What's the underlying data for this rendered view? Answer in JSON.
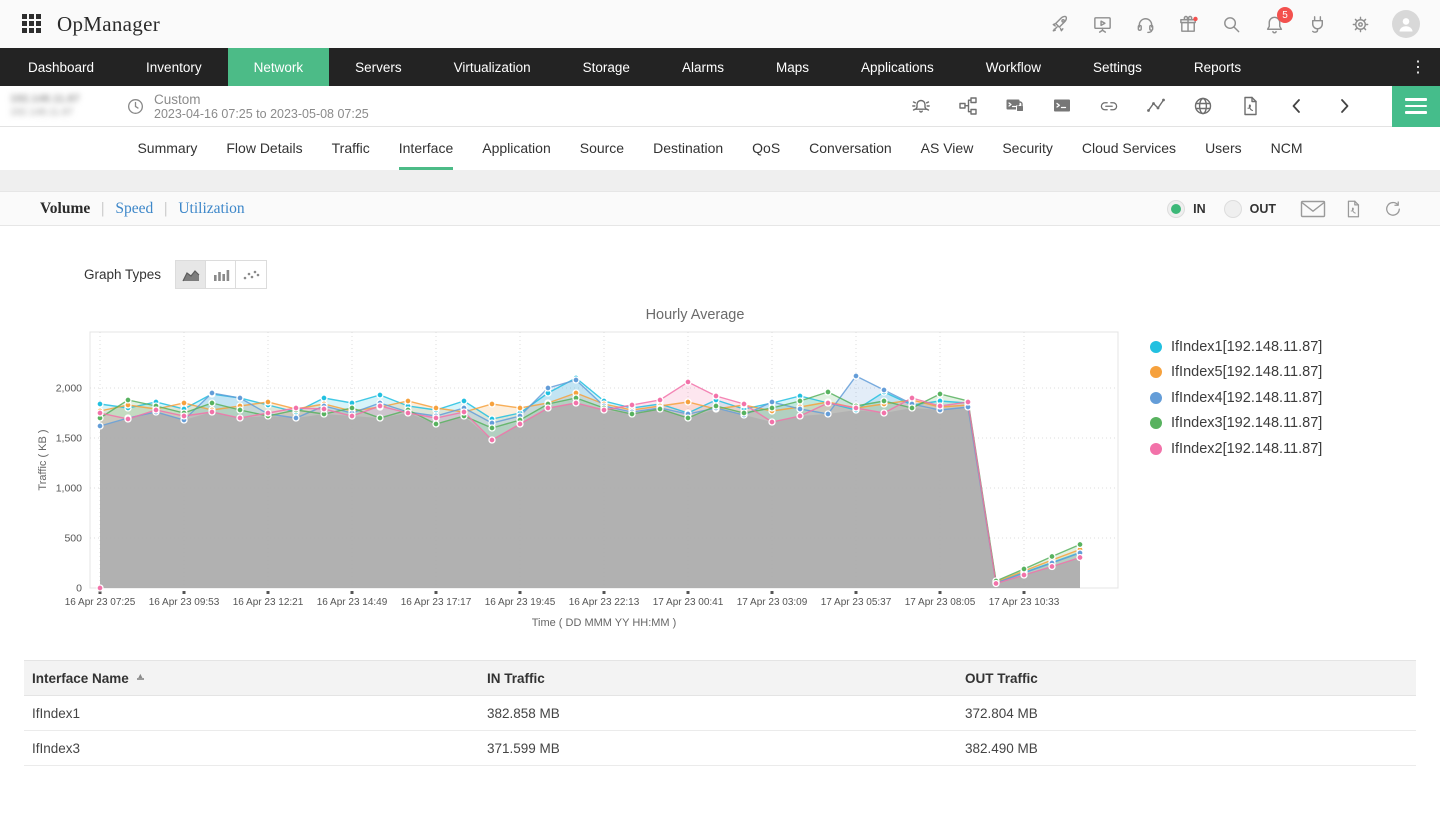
{
  "header": {
    "app_title": "OpManager",
    "notification_count": "5",
    "icons": [
      "apps-grid",
      "rocket",
      "demo-screen",
      "support-headset",
      "gift",
      "search",
      "notifications-bell",
      "integrations-plug",
      "settings-gear",
      "user-avatar"
    ]
  },
  "nav": {
    "items": [
      {
        "label": "Dashboard",
        "active": false
      },
      {
        "label": "Inventory",
        "active": false
      },
      {
        "label": "Network",
        "active": true
      },
      {
        "label": "Servers",
        "active": false
      },
      {
        "label": "Virtualization",
        "active": false
      },
      {
        "label": "Storage",
        "active": false
      },
      {
        "label": "Alarms",
        "active": false
      },
      {
        "label": "Maps",
        "active": false
      },
      {
        "label": "Applications",
        "active": false
      },
      {
        "label": "Workflow",
        "active": false
      },
      {
        "label": "Settings",
        "active": false
      },
      {
        "label": "Reports",
        "active": false
      }
    ],
    "overflow_menu": "⋮"
  },
  "subheader": {
    "device_label_line1": "192.148.11.87",
    "device_label_line2": "192.148.11.87",
    "device_label_redacted": true,
    "period_type": "Custom",
    "period_range": "2023-04-16 07:25 to 2023-05-08 07:25",
    "icons": [
      "alarm-bell",
      "topology",
      "secure-terminal",
      "terminal",
      "link",
      "performance-chart",
      "globe",
      "pdf-export",
      "chevron-left",
      "chevron-right",
      "menu"
    ]
  },
  "tabs": {
    "items": [
      "Summary",
      "Flow Details",
      "Traffic",
      "Interface",
      "Application",
      "Source",
      "Destination",
      "QoS",
      "Conversation",
      "AS View",
      "Security",
      "Cloud Services",
      "Users",
      "NCM"
    ],
    "active": "Interface"
  },
  "toolbar": {
    "views": [
      "Volume",
      "Speed",
      "Utilization"
    ],
    "active_view": "Volume",
    "in_label": "IN",
    "out_label": "OUT",
    "direction": "IN",
    "icons": [
      "email",
      "pdf",
      "refresh"
    ]
  },
  "graph_types": {
    "label": "Graph Types",
    "options": [
      "area",
      "bar",
      "scatter"
    ],
    "selected": "area"
  },
  "chart_data": {
    "type": "area",
    "title": "Hourly Average",
    "xlabel": "Time ( DD MMM YY HH:MM )",
    "ylabel": "Traffic ( KB )",
    "ylim": [
      0,
      2560
    ],
    "grid": true,
    "legend_position": "right",
    "fill_color": "#b0b0b0",
    "x_tick_every": 3,
    "x_tick_labels": [
      "16 Apr 23 07:25",
      "16 Apr 23 09:53",
      "16 Apr 23 12:21",
      "16 Apr 23 14:49",
      "16 Apr 23 17:17",
      "16 Apr 23 19:45",
      "16 Apr 23 22:13",
      "17 Apr 23 00:41",
      "17 Apr 23 03:09",
      "17 Apr 23 05:37",
      "17 Apr 23 08:05",
      "17 Apr 23 10:33"
    ],
    "y_ticks": [
      {
        "value": 0,
        "label": "0"
      },
      {
        "value": 500,
        "label": "500"
      },
      {
        "value": 1000,
        "label": "1,000"
      },
      {
        "value": 1500,
        "label": "1,500"
      },
      {
        "value": 2000,
        "label": "2,000"
      }
    ],
    "series": [
      {
        "name": "IfIndex1[192.148.11.87]",
        "color": "#22c0e0",
        "values": [
          1840,
          1800,
          1860,
          1790,
          1940,
          1900,
          1830,
          1760,
          1900,
          1850,
          1930,
          1820,
          1780,
          1870,
          1690,
          1750,
          1950,
          2100,
          1870,
          1800,
          1840,
          1750,
          1880,
          1790,
          1850,
          1920,
          1850,
          1780,
          1960,
          1830,
          1870,
          1850,
          55,
          155,
          255,
          355
        ]
      },
      {
        "name": "IfIndex5[192.148.11.87]",
        "color": "#f6a13d",
        "values": [
          1770,
          1830,
          1790,
          1850,
          1780,
          1820,
          1860,
          1790,
          1840,
          1770,
          1810,
          1870,
          1800,
          1760,
          1840,
          1800,
          1850,
          1950,
          1840,
          1780,
          1820,
          1860,
          1790,
          1830,
          1770,
          1810,
          1860,
          1800,
          1840,
          1880,
          1810,
          1830,
          60,
          170,
          280,
          385
        ]
      },
      {
        "name": "IfIndex4[192.148.11.87]",
        "color": "#649dd8",
        "values": [
          1620,
          1700,
          1760,
          1680,
          1950,
          1900,
          1740,
          1700,
          1820,
          1750,
          1850,
          1760,
          1720,
          1800,
          1650,
          1720,
          2000,
          2080,
          1820,
          1760,
          1800,
          1740,
          1800,
          1730,
          1860,
          1790,
          1740,
          2120,
          1980,
          1840,
          1780,
          1810,
          50,
          150,
          250,
          350
        ]
      },
      {
        "name": "IfIndex3[192.148.11.87]",
        "color": "#58b25f",
        "values": [
          1700,
          1880,
          1820,
          1750,
          1850,
          1780,
          1720,
          1780,
          1740,
          1800,
          1700,
          1780,
          1640,
          1720,
          1600,
          1680,
          1840,
          1900,
          1800,
          1740,
          1790,
          1700,
          1820,
          1750,
          1800,
          1870,
          1960,
          1820,
          1870,
          1800,
          1940,
          1870,
          70,
          190,
          315,
          435
        ]
      },
      {
        "name": "IfIndex2[192.148.11.87]",
        "color": "#f272a9",
        "values": [
          1750,
          1690,
          1780,
          1720,
          1760,
          1700,
          1750,
          1800,
          1790,
          1720,
          1820,
          1750,
          1700,
          1760,
          1480,
          1640,
          1800,
          1850,
          1780,
          1830,
          1880,
          2060,
          1920,
          1840,
          1660,
          1720,
          1850,
          1800,
          1750,
          1900,
          1820,
          1860,
          45,
          130,
          215,
          305
        ]
      }
    ],
    "origin_marker": {
      "series": "IfIndex2[192.148.11.87]",
      "x_index": 0,
      "value": 0
    }
  },
  "table": {
    "columns": [
      "Interface Name",
      "IN Traffic",
      "OUT Traffic"
    ],
    "sorted_column": "Interface Name",
    "rows": [
      [
        "IfIndex1",
        "382.858 MB",
        "372.804 MB"
      ],
      [
        "IfIndex3",
        "371.599 MB",
        "382.490 MB"
      ]
    ]
  }
}
